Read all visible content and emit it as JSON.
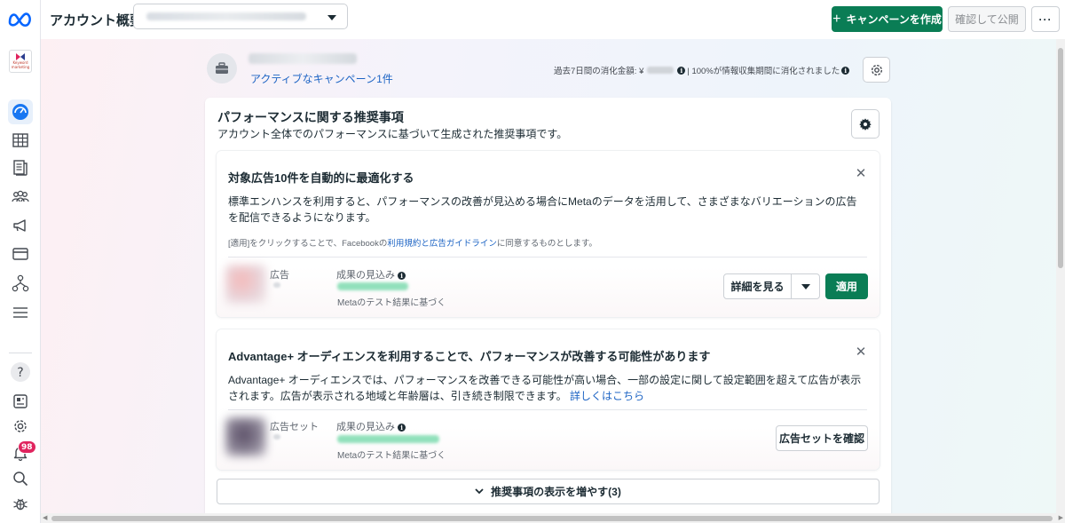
{
  "header": {
    "title": "アカウント概要",
    "create_button": "キャンペーンを作成",
    "create_icon": "+",
    "publish_button": "確認して公開",
    "more_button": "···"
  },
  "sidebar": {
    "account_logo_text": "Keyword marketing",
    "notification_count": "98",
    "items": [
      {
        "name": "account-overview",
        "icon": "speedometer-icon"
      },
      {
        "name": "campaigns",
        "icon": "table-icon"
      },
      {
        "name": "reports",
        "icon": "document-icon"
      },
      {
        "name": "audiences",
        "icon": "people-icon"
      },
      {
        "name": "advertising",
        "icon": "megaphone-icon"
      },
      {
        "name": "billing",
        "icon": "credit-card-icon"
      },
      {
        "name": "business-tools",
        "icon": "flow-icon"
      },
      {
        "name": "all-tools",
        "icon": "menu-icon"
      },
      {
        "name": "help",
        "icon": "question-icon"
      },
      {
        "name": "news",
        "icon": "news-icon"
      },
      {
        "name": "settings",
        "icon": "gear-icon"
      },
      {
        "name": "notifications",
        "icon": "bell-icon"
      },
      {
        "name": "search",
        "icon": "search-icon"
      },
      {
        "name": "bug-report",
        "icon": "bug-icon"
      }
    ]
  },
  "account": {
    "campaign_link": "アクティブなキャンペーン1件",
    "spend_prefix": "過去7日間の消化金額: ¥",
    "spend_suffix": "| 100%が情報収集期間に消化されました"
  },
  "recommendations": {
    "title": "パフォーマンスに関する推奨事項",
    "subtitle": "アカウント全体でのパフォーマンスに基づいて生成された推奨事項です。",
    "cards": [
      {
        "title": "対象広告10件を自動的に最適化する",
        "body": "標準エンハンスを利用すると、パフォーマンスの改善が見込める場合にMetaのデータを活用して、さまざまなバリエーションの広告を配信できるようになります。",
        "legal_prefix": "[適用]をクリックすることで、Facebookの",
        "legal_link": "利用規約と広告ガイドライン",
        "legal_suffix": "に同意するものとします。",
        "item_label": "広告",
        "estimate_label": "成果の見込み",
        "estimate_note": "Metaのテスト結果に基づく",
        "details_button": "詳細を見る",
        "apply_button": "適用"
      },
      {
        "title": "Advantage+ オーディエンスを利用することで、パフォーマンスが改善する可能性があります",
        "body": "Advantage+ オーディエンスでは、パフォーマンスを改善できる可能性が高い場合、一部の設定に関して設定範囲を超えて広告が表示されます。広告が表示される地域と年齢層は、引き続き制限できます。",
        "body_link": "詳しくはこちら",
        "item_label": "広告セット",
        "estimate_label": "成果の見込み",
        "estimate_note": "Metaのテスト結果に基づく",
        "review_button": "広告セットを確認"
      }
    ],
    "show_more": "推奨事項の表示を増やす(3)"
  },
  "colors": {
    "primary_green": "#0a7d55",
    "link_blue": "#1d64c4",
    "badge_red": "#e0245e"
  }
}
